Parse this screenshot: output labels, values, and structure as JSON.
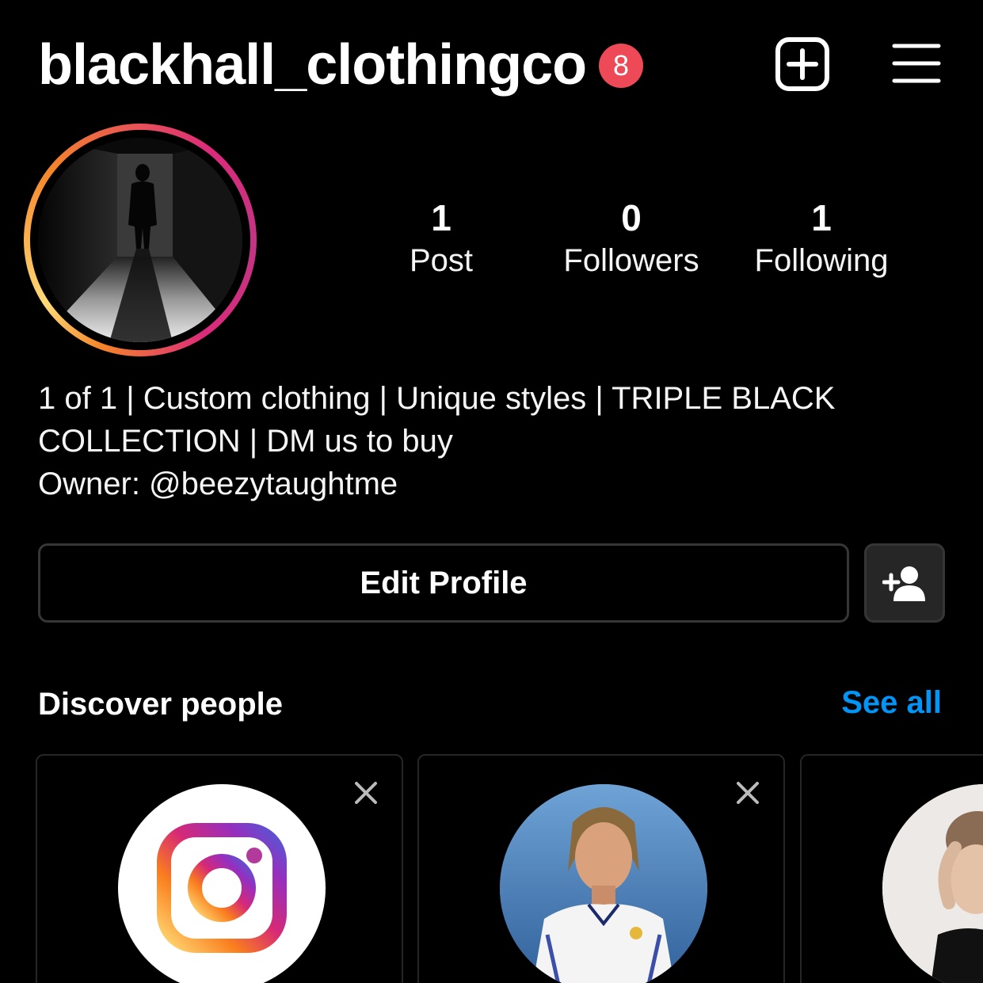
{
  "header": {
    "username": "blackhall_clothingco",
    "notification_count": "8",
    "new_post_icon": "plus-square-icon",
    "menu_icon": "hamburger-menu-icon"
  },
  "profile": {
    "stats": [
      {
        "value": "1",
        "label": "Post"
      },
      {
        "value": "0",
        "label": "Followers"
      },
      {
        "value": "1",
        "label": "Following"
      }
    ],
    "bio_lines": [
      "1 of 1 | Custom clothing | Unique styles | TRIPLE BLACK",
      "COLLECTION | DM us to buy",
      "Owner: @beezytaughtme"
    ]
  },
  "actions": {
    "edit_profile_label": "Edit Profile",
    "add_person_icon": "add-person-icon"
  },
  "discover": {
    "title": "Discover people",
    "see_all_label": "See all",
    "cards": [
      {
        "avatar": "instagram-logo"
      },
      {
        "avatar": "footballer-photo"
      },
      {
        "avatar": "woman-photo"
      }
    ]
  },
  "colors": {
    "background": "#000000",
    "badge": "#ed4956",
    "link": "#0095f6",
    "border": "#363636"
  }
}
